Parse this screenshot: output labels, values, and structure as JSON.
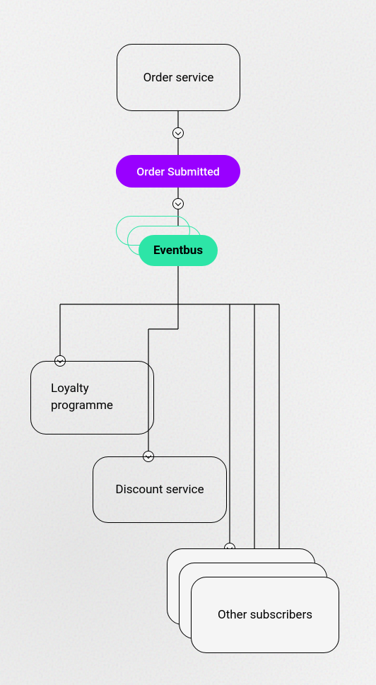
{
  "diagram": {
    "order_service": "Order service",
    "order_submitted": "Order Submitted",
    "eventbus": "Eventbus",
    "loyalty_programme": "Loyalty\nprogramme",
    "discount_service": "Discount service",
    "other_subscribers": "Other subscribers",
    "colors": {
      "accent_purple": "#9900ff",
      "accent_green": "#2de5a7"
    }
  }
}
